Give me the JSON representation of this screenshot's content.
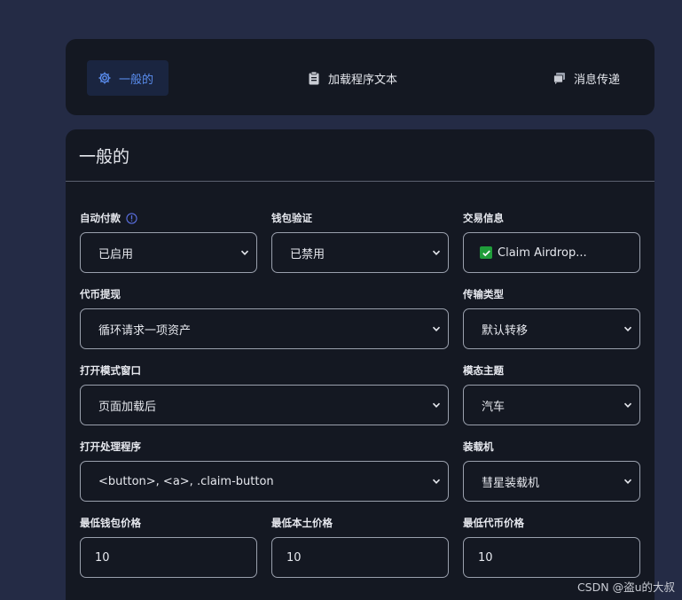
{
  "tabs": [
    {
      "label": "一般的",
      "icon": "gear-icon",
      "active": true
    },
    {
      "label": "加载程序文本",
      "icon": "clipboard-icon",
      "active": false
    },
    {
      "label": "消息传递",
      "icon": "messages-icon",
      "active": false
    }
  ],
  "card": {
    "title": "一般的"
  },
  "fields": {
    "auto_pay": {
      "label": "自动付款",
      "value": "已启用"
    },
    "wallet_verify": {
      "label": "钱包验证",
      "value": "已禁用"
    },
    "tx_info": {
      "label": "交易信息",
      "value": "Claim Airdrop..."
    },
    "token_withdraw": {
      "label": "代币提现",
      "value": "循环请求一项资产"
    },
    "transfer_type": {
      "label": "传输类型",
      "value": "默认转移"
    },
    "open_modal": {
      "label": "打开模式窗口",
      "value": "页面加载后"
    },
    "modal_theme": {
      "label": "模态主题",
      "value": "汽车"
    },
    "open_handler": {
      "label": "打开处理程序",
      "value": "<button>, <a>, .claim-button"
    },
    "loader": {
      "label": "装载机",
      "value": "彗星装载机"
    },
    "min_wallet_price": {
      "label": "最低钱包价格",
      "value": "10"
    },
    "min_native_price": {
      "label": "最低本土价格",
      "value": "10"
    },
    "min_token_price": {
      "label": "最低代币价格",
      "value": "10"
    }
  },
  "colors": {
    "accent": "#5a8dee",
    "background": "#242b45",
    "card": "#141822",
    "check": "#1f9d3a"
  },
  "watermark": "CSDN @盗u的大叔"
}
